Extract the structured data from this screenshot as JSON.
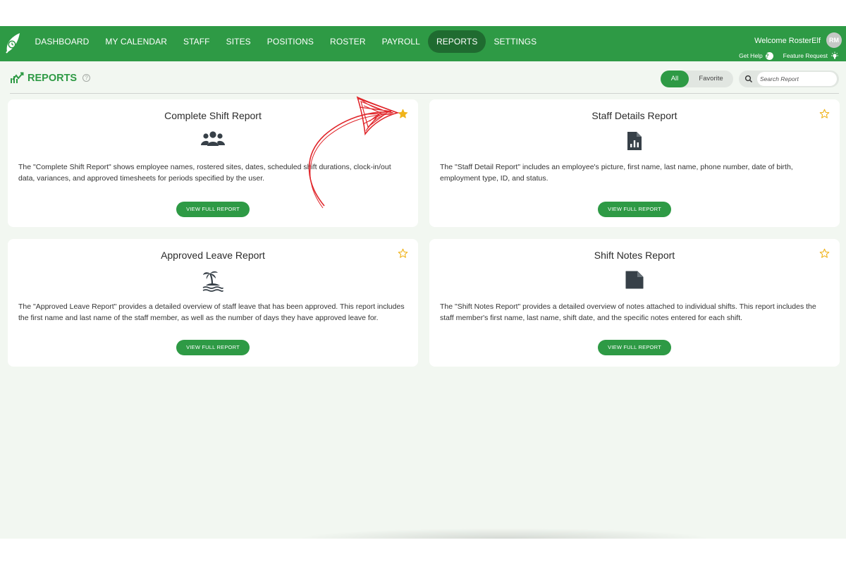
{
  "app": {
    "brand_color": "#2e9a45",
    "active_color": "#1f6b30"
  },
  "nav": {
    "items": [
      {
        "label": "DASHBOARD"
      },
      {
        "label": "MY CALENDAR"
      },
      {
        "label": "STAFF"
      },
      {
        "label": "SITES"
      },
      {
        "label": "POSITIONS"
      },
      {
        "label": "ROSTER"
      },
      {
        "label": "PAYROLL"
      },
      {
        "label": "REPORTS",
        "active": true
      },
      {
        "label": "SETTINGS"
      }
    ],
    "welcome": "Welcome RosterElf",
    "avatar_initials": "RM",
    "get_help": "Get Help",
    "feature_request": "Feature Request"
  },
  "page": {
    "title": "REPORTS",
    "filter_all": "All",
    "filter_favorite": "Favorite",
    "search_placeholder": "Search Report"
  },
  "reports": [
    {
      "title": "Complete Shift Report",
      "icon": "users-icon",
      "favorite": true,
      "description": "The \"Complete Shift Report\" shows employee names, rostered sites, dates, scheduled shift durations, clock-in/out data, variances, and approved timesheets for periods specified by the user.",
      "button": "VIEW FULL REPORT"
    },
    {
      "title": "Staff Details Report",
      "icon": "file-chart-icon",
      "favorite": false,
      "description": "The \"Staff Detail Report\" includes an employee's picture, first name, last name, phone number, date of birth, employment type, ID, and status.",
      "button": "VIEW FULL REPORT"
    },
    {
      "title": "Approved Leave Report",
      "icon": "island-icon",
      "favorite": false,
      "description": "The \"Approved Leave Report\" provides a detailed overview of staff leave that has been approved. This report includes the first name and last name of the staff member, as well as the number of days they have approved leave for.",
      "button": "VIEW FULL REPORT"
    },
    {
      "title": "Shift Notes Report",
      "icon": "file-icon",
      "favorite": false,
      "description": "The \"Shift Notes Report\" provides a detailed overview of notes attached to individual shifts. This report includes the staff member's first name, last name, shift date, and the specific notes entered for each shift.",
      "button": "VIEW FULL REPORT"
    }
  ]
}
